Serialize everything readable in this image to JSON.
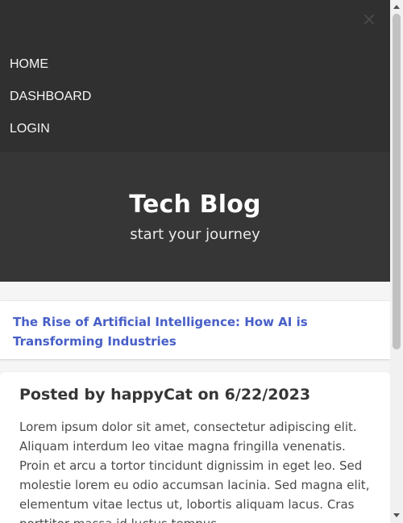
{
  "nav": {
    "close_icon": "×",
    "items": [
      {
        "label": "HOME"
      },
      {
        "label": "DASHBOARD"
      },
      {
        "label": "LOGIN"
      }
    ]
  },
  "hero": {
    "title": "Tech Blog",
    "subtitle": "start your journey"
  },
  "post": {
    "title": "The Rise of Artificial Intelligence: How AI is Transforming Industries",
    "meta": "Posted by happyCat on 6/22/2023",
    "body": "Lorem ipsum dolor sit amet, consectetur adipiscing elit. Aliquam interdum leo vitae magna fringilla venenatis. Proin et arcu a tortor tincidunt dignissim in eget leo. Sed molestie lorem eu odio accumsan lacinia. Sed magna elit, elementum vitae lectus ut, lobortis aliquam lacus. Cras porttitor massa id luctus tempus."
  },
  "colors": {
    "nav_bg": "#303030",
    "hero_bg": "#363636",
    "link": "#485fc7"
  }
}
